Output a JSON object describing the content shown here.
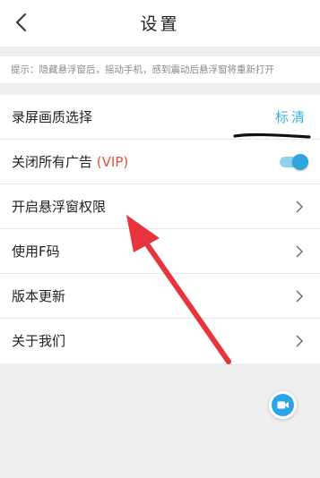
{
  "header": {
    "title": "设置",
    "back_icon": "chevron-left-icon"
  },
  "hint": {
    "text": "提示：隐藏悬浮窗后，摇动手机，感到震动后悬浮窗将重新打开"
  },
  "settings": {
    "items": [
      {
        "label": "录屏画质选择",
        "value": "标清"
      },
      {
        "label": "关闭所有广告",
        "badge": "(VIP)",
        "toggle_on": true
      },
      {
        "label": "开启悬浮窗权限",
        "icon": "chevron-right-icon"
      },
      {
        "label": "使用F码",
        "icon": "chevron-right-icon"
      },
      {
        "label": "版本更新",
        "icon": "chevron-right-icon"
      },
      {
        "label": "关于我们",
        "icon": "chevron-right-icon"
      }
    ]
  },
  "floating_button": {
    "icon": "video-camera-icon"
  },
  "colors": {
    "accent": "#3ab0e2",
    "toggle": "#2fa6dd",
    "vip": "#e0533b",
    "annotation_arrow": "#e8343c"
  }
}
